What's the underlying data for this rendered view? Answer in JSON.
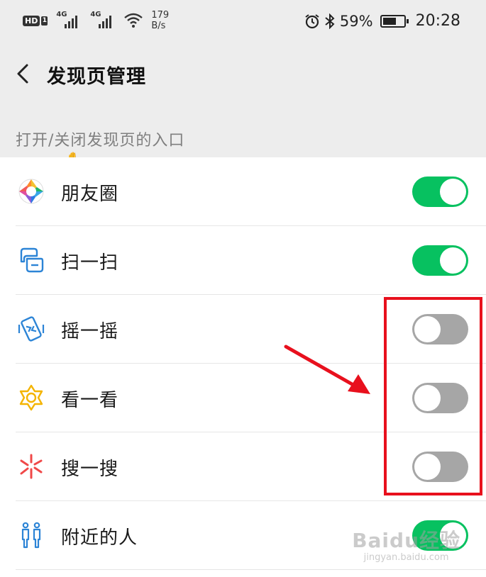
{
  "status_bar": {
    "hd": "HD",
    "sim_slot": "1",
    "network_1": "4G",
    "network_2": "4G",
    "speed_value": "179",
    "speed_unit": "B/s",
    "battery": "59%",
    "battery_level": 0.59,
    "time": "20:28"
  },
  "header": {
    "back_icon": "chevron-left-icon",
    "title": "发现页管理"
  },
  "section_label": "打开/关闭发现页的入口",
  "items": [
    {
      "label": "朋友圈",
      "icon": "moments-aperture-icon",
      "enabled": true
    },
    {
      "label": "扫一扫",
      "icon": "scan-icon",
      "enabled": true
    },
    {
      "label": "摇一摇",
      "icon": "shake-phone-icon",
      "enabled": false
    },
    {
      "label": "看一看",
      "icon": "top-stories-star-icon",
      "enabled": false
    },
    {
      "label": "搜一搜",
      "icon": "search-sparkle-icon",
      "enabled": false
    },
    {
      "label": "附近的人",
      "icon": "people-nearby-icon",
      "enabled": true
    }
  ],
  "annotation": {
    "color": "#e8101d"
  },
  "watermark": {
    "main": "Baidu经验",
    "sub": "jingyan.baidu.com"
  },
  "colors": {
    "toggle_on": "#07c160",
    "toggle_off": "#a6a6a6",
    "background_gray": "#ededed"
  }
}
